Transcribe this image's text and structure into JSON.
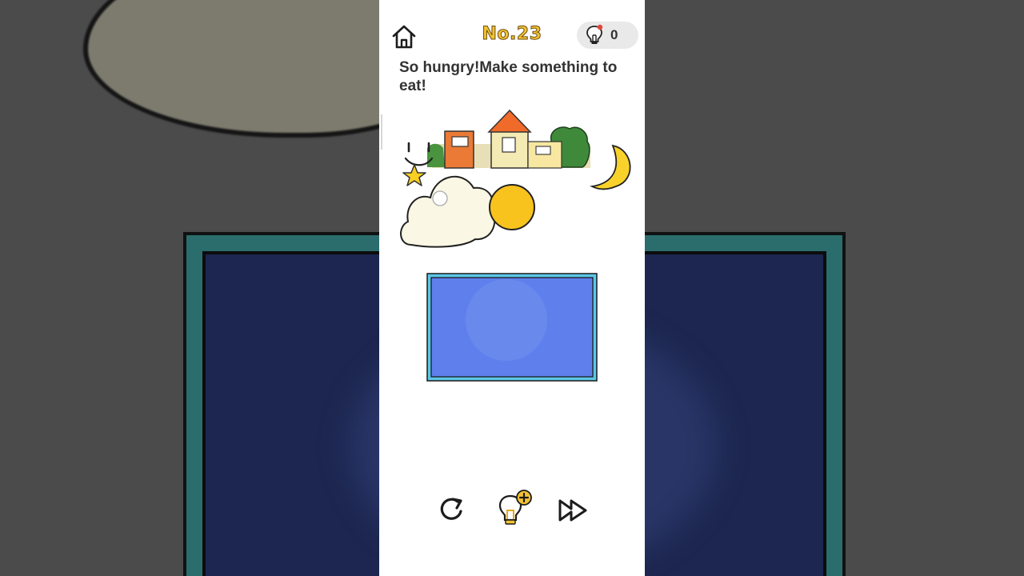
{
  "level": {
    "label": "No.23"
  },
  "hints": {
    "count": "0"
  },
  "puzzle": {
    "prompt": "So hungry!Make something to eat!"
  },
  "scene_items": {
    "sun": "sun",
    "cloud": "cloud",
    "moon": "moon",
    "star": "star",
    "town": "town-strip",
    "smiley": "smiley-face"
  },
  "controls": {
    "home": "home-icon",
    "restart": "restart-icon",
    "hint": "add-hint-icon",
    "skip": "skip-icon"
  },
  "colors": {
    "title_yellow": "#f2c232",
    "screen_blue": "#5f80ec",
    "screen_border": "#5cc6e8",
    "sun_yellow": "#f8c31c",
    "moon_yellow": "#f8d22a",
    "cloud_cream": "#faf7e4"
  }
}
